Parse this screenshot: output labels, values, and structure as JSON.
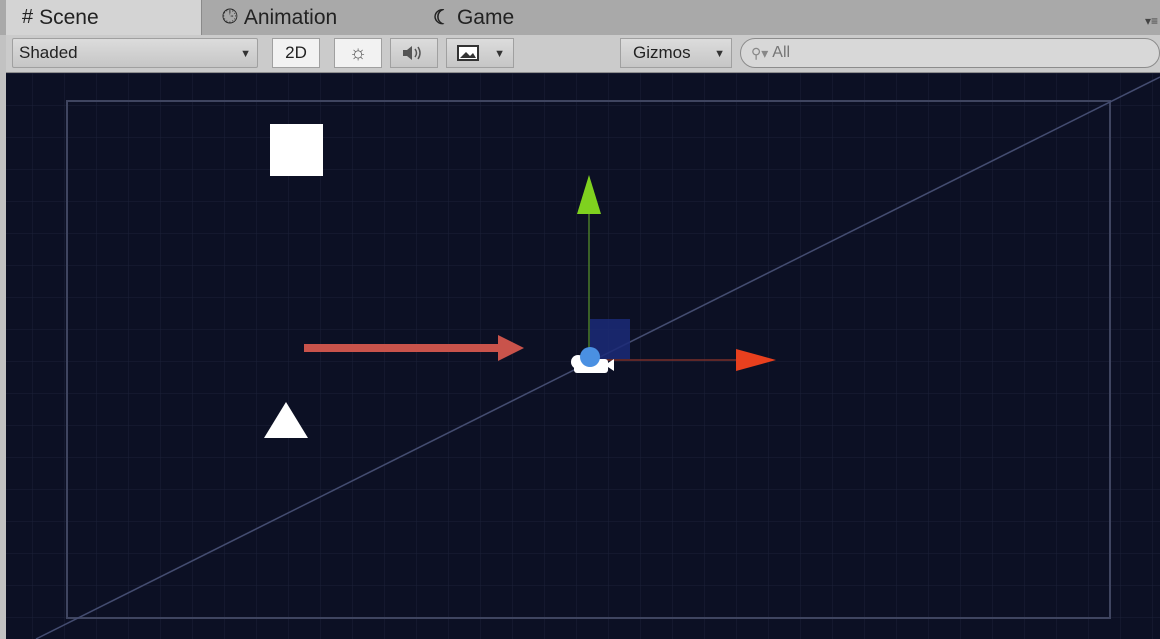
{
  "tabs": [
    {
      "label": "Scene",
      "icon": "hash-icon",
      "active": true
    },
    {
      "label": "Animation",
      "icon": "clock-icon",
      "active": false
    },
    {
      "label": "Game",
      "icon": "pacman-icon",
      "active": false
    }
  ],
  "toolbar": {
    "draw_mode": "Shaded",
    "mode_2d": "2D",
    "gizmos": "Gizmos",
    "search_placeholder": "All"
  },
  "scene": {
    "background": "#0c1024",
    "gizmo_colors": {
      "x_axis": "#e8401e",
      "y_axis": "#7fd11f",
      "drag_arrow": "#c9534b",
      "camera": "#4a90e2"
    }
  }
}
